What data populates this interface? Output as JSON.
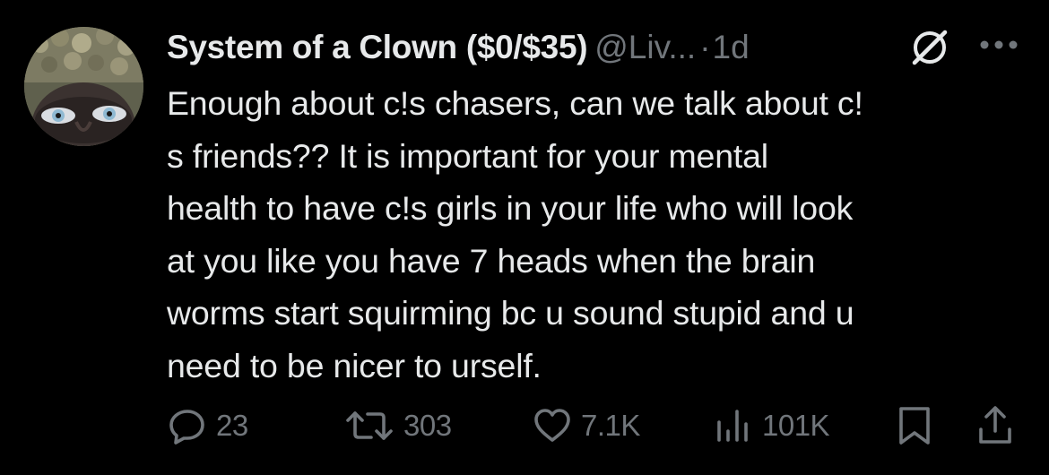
{
  "post": {
    "author": {
      "display_name": "System of a Clown ($0/$35)",
      "handle": "@Liv...",
      "avatar_icon": "profile-avatar"
    },
    "separator": "·",
    "time": "1d",
    "text": "Enough about c!s chasers, can we talk about c!\ns friends?? It is important for your mental\nhealth to have c!s girls in your life who will look\nat you like you have 7 heads when the brain\nworms start squirming bc u sound stupid and u\nneed to be nicer to urself.",
    "icons": {
      "grok": "grok-icon",
      "more": "more-icon"
    }
  },
  "actions": {
    "reply": {
      "icon": "reply-icon",
      "count": "23"
    },
    "retweet": {
      "icon": "retweet-icon",
      "count": "303"
    },
    "like": {
      "icon": "heart-icon",
      "count": "7.1K"
    },
    "views": {
      "icon": "views-icon",
      "count": "101K"
    },
    "bookmark": {
      "icon": "bookmark-icon"
    },
    "share": {
      "icon": "share-icon"
    }
  },
  "colors": {
    "background": "#000000",
    "primary_text": "#e7e9ea",
    "secondary_text": "#71767b"
  }
}
